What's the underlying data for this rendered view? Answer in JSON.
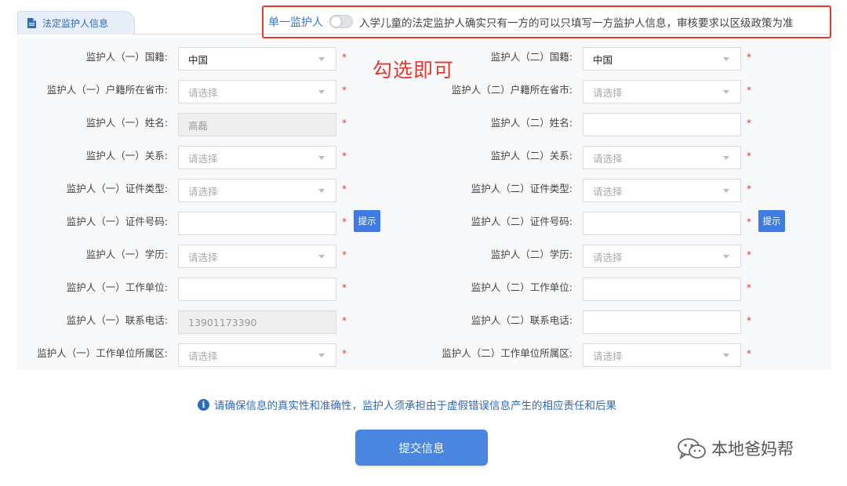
{
  "tab": {
    "label": "法定监护人信息",
    "icon": "document-icon"
  },
  "single_guardian": {
    "label": "单一监护人",
    "note": "入学儿童的法定监护人确实只有一方的可以只填写一方监护人信息，审核要求以区级政策为准",
    "enabled": false
  },
  "annotation": "勾选即可",
  "guardian1": {
    "nationality": {
      "label": "监护人（一）国籍:",
      "value": "中国"
    },
    "province": {
      "label": "监护人（一）户籍所在省市:",
      "placeholder": "请选择"
    },
    "name": {
      "label": "监护人（一）姓名:",
      "value": "高磊"
    },
    "relation": {
      "label": "监护人（一）关系:",
      "placeholder": "请选择"
    },
    "id_type": {
      "label": "监护人（一）证件类型:",
      "placeholder": "请选择"
    },
    "id_number": {
      "label": "监护人（一）证件号码:",
      "value": "",
      "hint_label": "提示"
    },
    "education": {
      "label": "监护人（一）学历:",
      "placeholder": "请选择"
    },
    "employer": {
      "label": "监护人（一）工作单位:",
      "value": ""
    },
    "phone": {
      "label": "监护人（一）联系电话:",
      "value": "13901173390"
    },
    "employer_district": {
      "label": "监护人（一）工作单位所属区:",
      "placeholder": "请选择"
    }
  },
  "guardian2": {
    "nationality": {
      "label": "监护人（二）国籍:",
      "value": "中国"
    },
    "province": {
      "label": "监护人（二）户籍所在省市:",
      "placeholder": "请选择"
    },
    "name": {
      "label": "监护人（二）姓名:",
      "value": ""
    },
    "relation": {
      "label": "监护人（二）关系:",
      "placeholder": "请选择"
    },
    "id_type": {
      "label": "监护人（二）证件类型:",
      "placeholder": "请选择"
    },
    "id_number": {
      "label": "监护人（二）证件号码:",
      "value": "",
      "hint_label": "提示"
    },
    "education": {
      "label": "监护人（二）学历:",
      "placeholder": "请选择"
    },
    "employer": {
      "label": "监护人（二）工作单位:",
      "value": ""
    },
    "phone": {
      "label": "监护人（二）联系电话:",
      "value": ""
    },
    "employer_district": {
      "label": "监护人（二）工作单位所属区:",
      "placeholder": "请选择"
    }
  },
  "required_mark": "*",
  "notice": "请确保信息的真实性和准确性，监护人须承担由于虚假错误信息产生的相应责任和后果",
  "submit_label": "提交信息",
  "watermark": "本地爸妈帮",
  "colors": {
    "accent": "#4a86e0",
    "highlight": "#e23a2e",
    "link": "#2f6ab8"
  }
}
